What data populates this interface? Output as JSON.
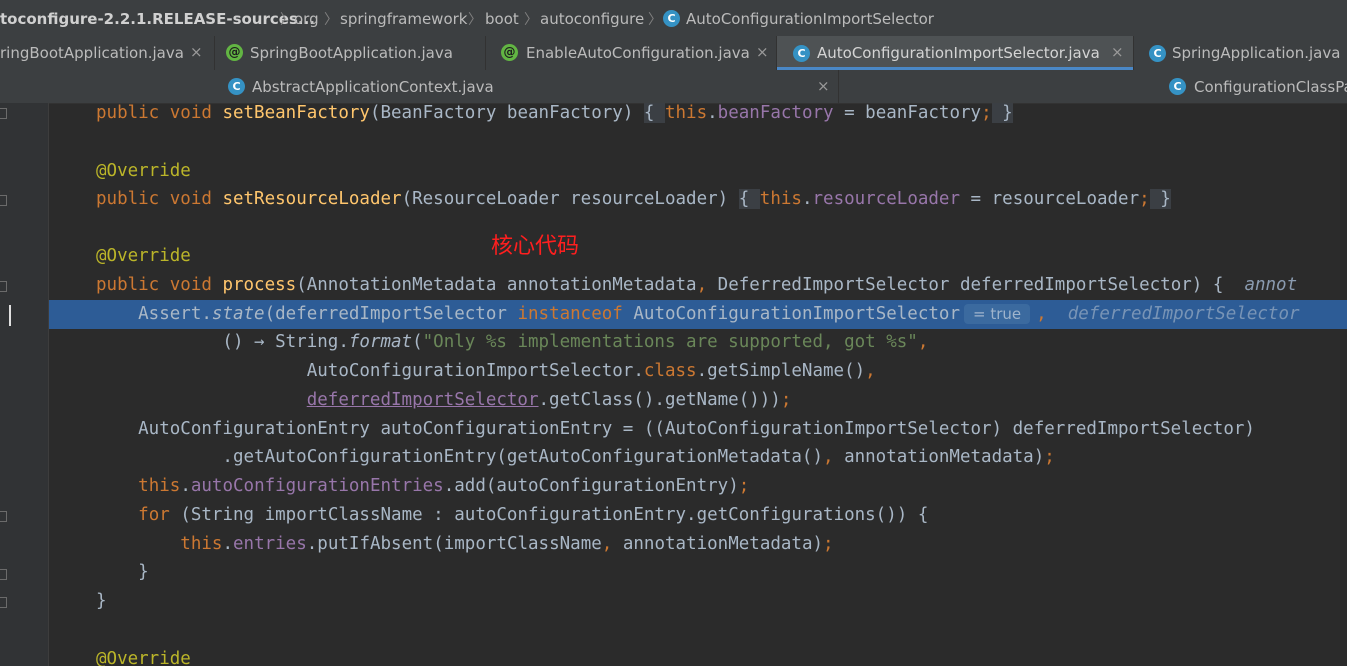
{
  "breadcrumb": {
    "items": [
      "toconfigure-2.2.1.RELEASE-sources...",
      "org",
      "springframework",
      "boot",
      "autoconfigure",
      "AutoConfigurationImportSelector"
    ],
    "separator": "〉",
    "class_icon_letter": "C"
  },
  "tabs_row1": [
    {
      "label": "ringBootApplication.java",
      "icon": "none",
      "active": false
    },
    {
      "label": "SpringBootApplication.java",
      "icon": "annotation-icon",
      "active": false
    },
    {
      "label": "EnableAutoConfiguration.java",
      "icon": "annotation-icon",
      "active": false
    },
    {
      "label": "AutoConfigurationImportSelector.java",
      "icon": "class-icon",
      "active": true
    },
    {
      "label": "SpringApplication.java",
      "icon": "class-icon",
      "active": false
    }
  ],
  "tabs_row2": [
    {
      "label": "AbstractApplicationContext.java",
      "icon": "class-icon",
      "active": false
    },
    {
      "label": "ConfigurationClassPa",
      "icon": "class-icon",
      "active": false
    }
  ],
  "tab_close_glyph": "×",
  "annotation_icon_glyph": "@",
  "inline_hint": "= true",
  "param_hint_right_1": "annot",
  "param_hint_right_2": "deferredImportSelector",
  "note": "核心代码",
  "colors": {
    "keyword": "#cc7832",
    "method": "#ffc66d",
    "annotation": "#bbb529",
    "field": "#9876aa",
    "string": "#6a8759",
    "text": "#a9b7c6",
    "highlight_line": "#2d5c96",
    "note": "#ff1f1f"
  }
}
